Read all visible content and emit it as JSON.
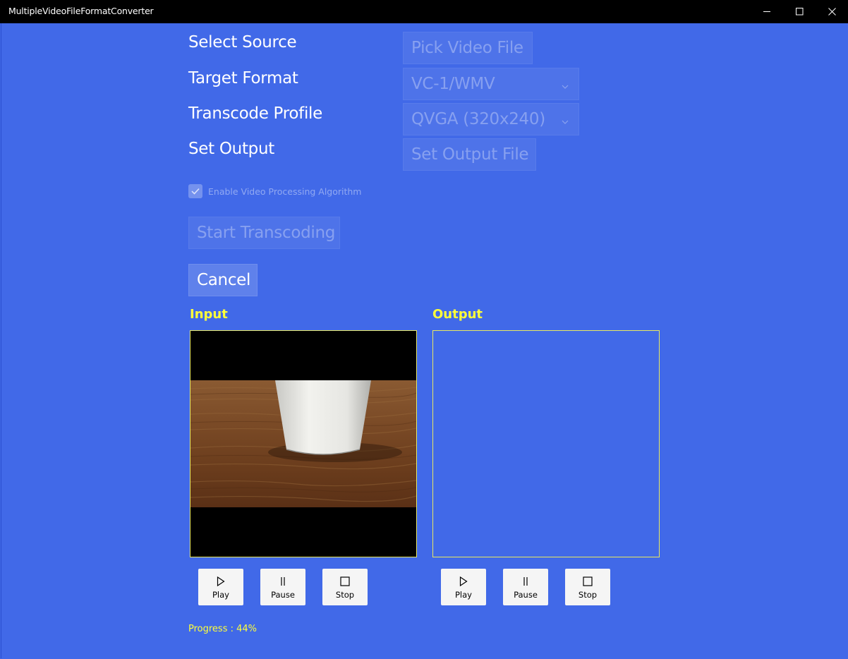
{
  "window": {
    "title": "MultipleVideoFileFormatConverter"
  },
  "form": {
    "select_source_label": "Select Source",
    "pick_video_button": "Pick Video File",
    "target_format_label": "Target Format",
    "target_format_value": "VC-1/WMV",
    "transcode_profile_label": "Transcode Profile",
    "transcode_profile_value": "QVGA (320x240)",
    "set_output_label": "Set Output",
    "set_output_button": "Set Output File",
    "enable_processing_label": "Enable Video Processing Algorithm",
    "enable_processing_checked": true,
    "start_button": "Start Transcoding",
    "cancel_button": "Cancel"
  },
  "input_panel": {
    "title": "Input",
    "play": "Play",
    "pause": "Pause",
    "stop": "Stop"
  },
  "output_panel": {
    "title": "Output",
    "play": "Play",
    "pause": "Pause",
    "stop": "Stop"
  },
  "status": {
    "progress_text": "Progress : 44%"
  },
  "colors": {
    "background": "#4169e8",
    "accent_yellow": "#ffff3a",
    "titlebar": "#000000"
  }
}
